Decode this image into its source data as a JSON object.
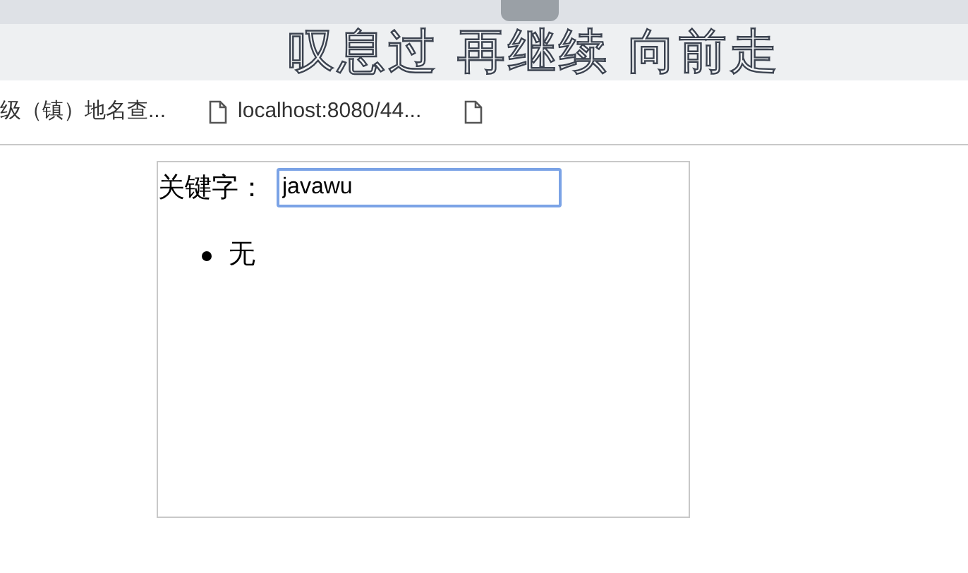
{
  "browser": {
    "banner": "叹息过 再继续 向前走",
    "bookmarks": [
      {
        "kind": "text",
        "label": "级（镇）地名查..."
      },
      {
        "kind": "page",
        "label": "localhost:8080/44..."
      },
      {
        "kind": "page"
      }
    ]
  },
  "search": {
    "label": "关键字：",
    "value": "javawu",
    "focused": true
  },
  "results": [
    "无"
  ]
}
